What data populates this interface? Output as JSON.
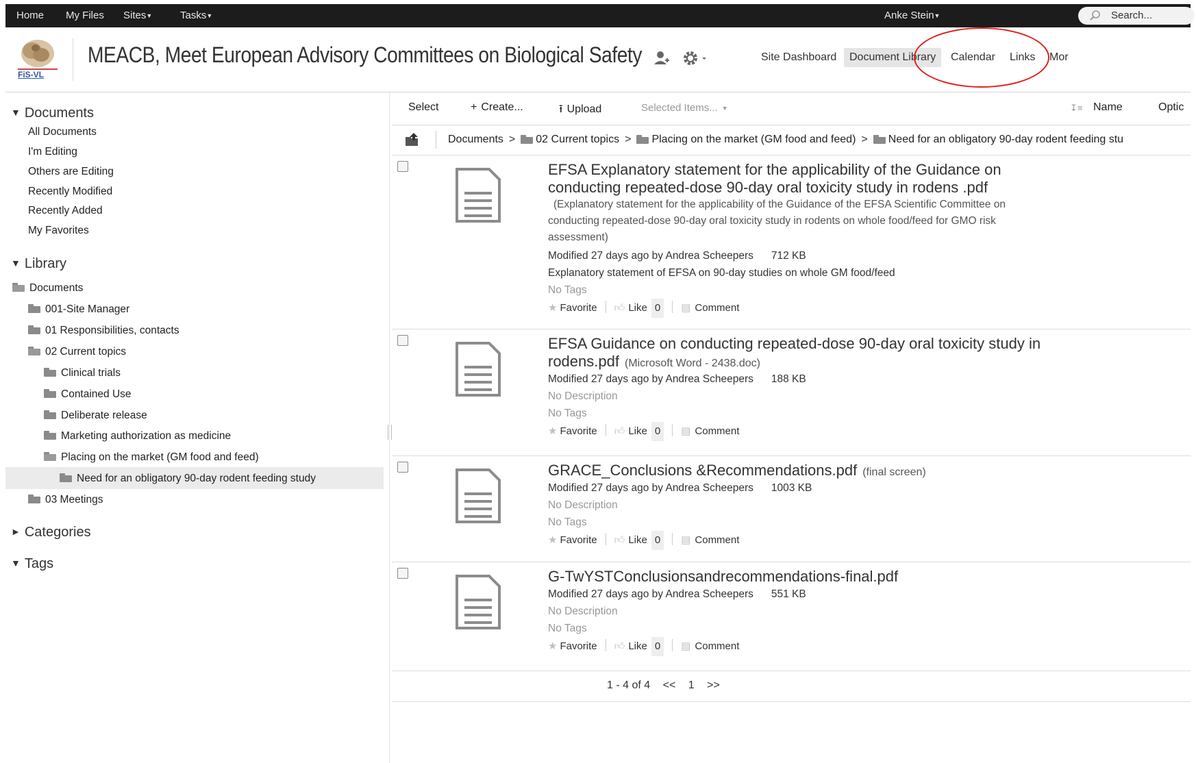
{
  "topbar": {
    "home": "Home",
    "my_files": "My Files",
    "sites": "Sites",
    "tasks": "Tasks",
    "user": "Anke Stein",
    "search_placeholder": "Search..."
  },
  "site": {
    "logo_text": "FiS-VL",
    "title": "MEACB, Meet European Advisory Committees on Biological Safety",
    "nav": {
      "dashboard": "Site Dashboard",
      "doclib": "Document Library",
      "calendar": "Calendar",
      "links": "Links",
      "more": "Mor"
    }
  },
  "sidebar": {
    "documents_header": "Documents",
    "filters": [
      "All Documents",
      "I'm Editing",
      "Others are Editing",
      "Recently Modified",
      "Recently Added",
      "My Favorites"
    ],
    "library_header": "Library",
    "tree": {
      "root": "Documents",
      "site_manager": "001-Site Manager",
      "responsibilities": "01 Responsibilities, contacts",
      "current_topics": "02 Current topics",
      "clinical": "Clinical trials",
      "contained": "Contained Use",
      "deliberate": "Deliberate release",
      "marketing": "Marketing authorization as medicine",
      "placing": "Placing on the market (GM food and feed)",
      "need": "Need for an obligatory 90-day rodent feeding study",
      "meetings": "03 Meetings"
    },
    "categories_header": "Categories",
    "tags_header": "Tags"
  },
  "toolbar": {
    "select": "Select",
    "create": "Create...",
    "upload": "Upload",
    "selected_items": "Selected Items...",
    "sort": "Name",
    "options": "Optic"
  },
  "breadcrumb": {
    "documents": "Documents",
    "current_topics": "02 Current topics",
    "placing": "Placing on the market (GM food and feed)",
    "need": "Need for an obligatory 90-day rodent feeding stu"
  },
  "labels": {
    "favorite": "Favorite",
    "like": "Like",
    "comment": "Comment"
  },
  "documents": [
    {
      "title": "EFSA Explanatory statement for the applicability of the Guidance on conducting repeated-dose 90-day oral toxicity study in rodens .pdf",
      "subtitle": "(Explanatory statement for the applicability of the Guidance of the EFSA Scientific Committee on conducting repeated-dose 90-day oral toxicity study in rodents on whole food/feed for GMO risk assessment)",
      "modified": "Modified 27 days ago by Andrea Scheepers",
      "size": "712 KB",
      "description": "Explanatory statement of EFSA on 90-day studies on whole GM food/feed",
      "tags": "No Tags",
      "likes": "0"
    },
    {
      "title": "EFSA Guidance on conducting repeated-dose 90-day oral toxicity study in rodens.pdf",
      "subtitle": "(Microsoft Word - 2438.doc)",
      "modified": "Modified 27 days ago by Andrea Scheepers",
      "size": "188 KB",
      "description": "No Description",
      "tags": "No Tags",
      "likes": "0"
    },
    {
      "title": "GRACE_Conclusions &Recommendations.pdf",
      "subtitle": "(final screen)",
      "modified": "Modified 27 days ago by Andrea Scheepers",
      "size": "1003 KB",
      "description": "No Description",
      "tags": "No Tags",
      "likes": "0"
    },
    {
      "title": "G-TwYSTConclusionsandrecommendations-final.pdf",
      "modified": "Modified 27 days ago by Andrea Scheepers",
      "size": "551 KB",
      "description": "No Description",
      "tags": "No Tags",
      "likes": "0"
    }
  ],
  "pager": {
    "range": "1 - 4 of 4",
    "prev": "<<",
    "page": "1",
    "next": ">>"
  },
  "colors": {
    "topbar_bg": "#1c1c1c",
    "highlight_circle": "#e0201a",
    "selected_bg": "#ebebeb"
  }
}
